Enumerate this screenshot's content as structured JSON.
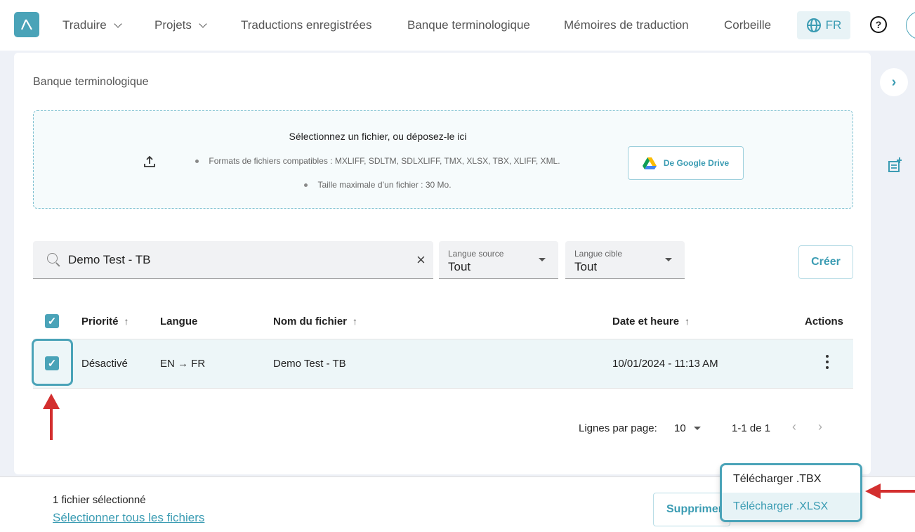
{
  "nav": {
    "items": [
      {
        "label": "Traduire",
        "has_dropdown": true
      },
      {
        "label": "Projets",
        "has_dropdown": true
      },
      {
        "label": "Traductions enregistrées",
        "has_dropdown": false
      },
      {
        "label": "Banque terminologique",
        "has_dropdown": false
      },
      {
        "label": "Mémoires de traduction",
        "has_dropdown": false
      },
      {
        "label": "Corbeille",
        "has_dropdown": false
      }
    ],
    "language": "FR",
    "help_symbol": "?"
  },
  "page": {
    "title": "Banque terminologique"
  },
  "upload": {
    "title": "Sélectionnez un fichier, ou déposez-le ici",
    "formats": "Formats de fichiers compatibles : MXLIFF, SDLTM, SDLXLIFF, TMX, XLSX, TBX, XLIFF, XML.",
    "max_size": "Taille maximale d’un fichier : 30 Mo.",
    "gdrive_label": "De Google Drive"
  },
  "filters": {
    "search_value": "Demo Test - TB",
    "source_lang_label": "Langue source",
    "source_lang_value": "Tout",
    "target_lang_label": "Langue cible",
    "target_lang_value": "Tout",
    "create_label": "Créer"
  },
  "table": {
    "columns": [
      "Priorité",
      "Langue",
      "Nom du fichier",
      "Date et heure",
      "Actions"
    ],
    "rows": [
      {
        "selected": true,
        "priority": "Désactivé",
        "language": "EN → FR",
        "filename": "Demo Test - TB",
        "datetime": "10/01/2024 - 11:13 AM"
      }
    ]
  },
  "pagination": {
    "rows_per_page_label": "Lignes par page:",
    "rows_per_page_value": "10",
    "range": "1-1 de 1"
  },
  "bottom_bar": {
    "selected_count": "1 fichier sélectionné",
    "select_all": "Sélectionner tous les fichiers",
    "delete_label": "Supprimer"
  },
  "menu": {
    "items": [
      "Télécharger .TBX",
      "Télécharger .XLSX"
    ]
  },
  "colors": {
    "accent": "#4aa3b8",
    "annotation_arrow": "#d32f2f"
  }
}
